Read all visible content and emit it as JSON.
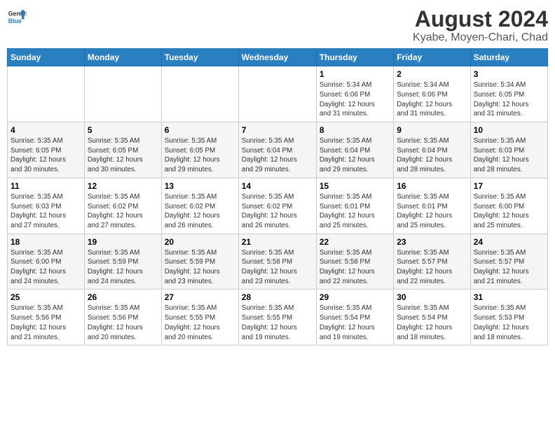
{
  "header": {
    "logo_line1": "General",
    "logo_line2": "Blue",
    "title": "August 2024",
    "subtitle": "Kyabe, Moyen-Chari, Chad"
  },
  "weekdays": [
    "Sunday",
    "Monday",
    "Tuesday",
    "Wednesday",
    "Thursday",
    "Friday",
    "Saturday"
  ],
  "weeks": [
    [
      {
        "day": "",
        "detail": ""
      },
      {
        "day": "",
        "detail": ""
      },
      {
        "day": "",
        "detail": ""
      },
      {
        "day": "",
        "detail": ""
      },
      {
        "day": "1",
        "detail": "Sunrise: 5:34 AM\nSunset: 6:06 PM\nDaylight: 12 hours\nand 31 minutes."
      },
      {
        "day": "2",
        "detail": "Sunrise: 5:34 AM\nSunset: 6:06 PM\nDaylight: 12 hours\nand 31 minutes."
      },
      {
        "day": "3",
        "detail": "Sunrise: 5:34 AM\nSunset: 6:05 PM\nDaylight: 12 hours\nand 31 minutes."
      }
    ],
    [
      {
        "day": "4",
        "detail": "Sunrise: 5:35 AM\nSunset: 6:05 PM\nDaylight: 12 hours\nand 30 minutes."
      },
      {
        "day": "5",
        "detail": "Sunrise: 5:35 AM\nSunset: 6:05 PM\nDaylight: 12 hours\nand 30 minutes."
      },
      {
        "day": "6",
        "detail": "Sunrise: 5:35 AM\nSunset: 6:05 PM\nDaylight: 12 hours\nand 29 minutes."
      },
      {
        "day": "7",
        "detail": "Sunrise: 5:35 AM\nSunset: 6:04 PM\nDaylight: 12 hours\nand 29 minutes."
      },
      {
        "day": "8",
        "detail": "Sunrise: 5:35 AM\nSunset: 6:04 PM\nDaylight: 12 hours\nand 29 minutes."
      },
      {
        "day": "9",
        "detail": "Sunrise: 5:35 AM\nSunset: 6:04 PM\nDaylight: 12 hours\nand 28 minutes."
      },
      {
        "day": "10",
        "detail": "Sunrise: 5:35 AM\nSunset: 6:03 PM\nDaylight: 12 hours\nand 28 minutes."
      }
    ],
    [
      {
        "day": "11",
        "detail": "Sunrise: 5:35 AM\nSunset: 6:03 PM\nDaylight: 12 hours\nand 27 minutes."
      },
      {
        "day": "12",
        "detail": "Sunrise: 5:35 AM\nSunset: 6:02 PM\nDaylight: 12 hours\nand 27 minutes."
      },
      {
        "day": "13",
        "detail": "Sunrise: 5:35 AM\nSunset: 6:02 PM\nDaylight: 12 hours\nand 26 minutes."
      },
      {
        "day": "14",
        "detail": "Sunrise: 5:35 AM\nSunset: 6:02 PM\nDaylight: 12 hours\nand 26 minutes."
      },
      {
        "day": "15",
        "detail": "Sunrise: 5:35 AM\nSunset: 6:01 PM\nDaylight: 12 hours\nand 25 minutes."
      },
      {
        "day": "16",
        "detail": "Sunrise: 5:35 AM\nSunset: 6:01 PM\nDaylight: 12 hours\nand 25 minutes."
      },
      {
        "day": "17",
        "detail": "Sunrise: 5:35 AM\nSunset: 6:00 PM\nDaylight: 12 hours\nand 25 minutes."
      }
    ],
    [
      {
        "day": "18",
        "detail": "Sunrise: 5:35 AM\nSunset: 6:00 PM\nDaylight: 12 hours\nand 24 minutes."
      },
      {
        "day": "19",
        "detail": "Sunrise: 5:35 AM\nSunset: 5:59 PM\nDaylight: 12 hours\nand 24 minutes."
      },
      {
        "day": "20",
        "detail": "Sunrise: 5:35 AM\nSunset: 5:59 PM\nDaylight: 12 hours\nand 23 minutes."
      },
      {
        "day": "21",
        "detail": "Sunrise: 5:35 AM\nSunset: 5:58 PM\nDaylight: 12 hours\nand 23 minutes."
      },
      {
        "day": "22",
        "detail": "Sunrise: 5:35 AM\nSunset: 5:58 PM\nDaylight: 12 hours\nand 22 minutes."
      },
      {
        "day": "23",
        "detail": "Sunrise: 5:35 AM\nSunset: 5:57 PM\nDaylight: 12 hours\nand 22 minutes."
      },
      {
        "day": "24",
        "detail": "Sunrise: 5:35 AM\nSunset: 5:57 PM\nDaylight: 12 hours\nand 21 minutes."
      }
    ],
    [
      {
        "day": "25",
        "detail": "Sunrise: 5:35 AM\nSunset: 5:56 PM\nDaylight: 12 hours\nand 21 minutes."
      },
      {
        "day": "26",
        "detail": "Sunrise: 5:35 AM\nSunset: 5:56 PM\nDaylight: 12 hours\nand 20 minutes."
      },
      {
        "day": "27",
        "detail": "Sunrise: 5:35 AM\nSunset: 5:55 PM\nDaylight: 12 hours\nand 20 minutes."
      },
      {
        "day": "28",
        "detail": "Sunrise: 5:35 AM\nSunset: 5:55 PM\nDaylight: 12 hours\nand 19 minutes."
      },
      {
        "day": "29",
        "detail": "Sunrise: 5:35 AM\nSunset: 5:54 PM\nDaylight: 12 hours\nand 19 minutes."
      },
      {
        "day": "30",
        "detail": "Sunrise: 5:35 AM\nSunset: 5:54 PM\nDaylight: 12 hours\nand 18 minutes."
      },
      {
        "day": "31",
        "detail": "Sunrise: 5:35 AM\nSunset: 5:53 PM\nDaylight: 12 hours\nand 18 minutes."
      }
    ]
  ]
}
